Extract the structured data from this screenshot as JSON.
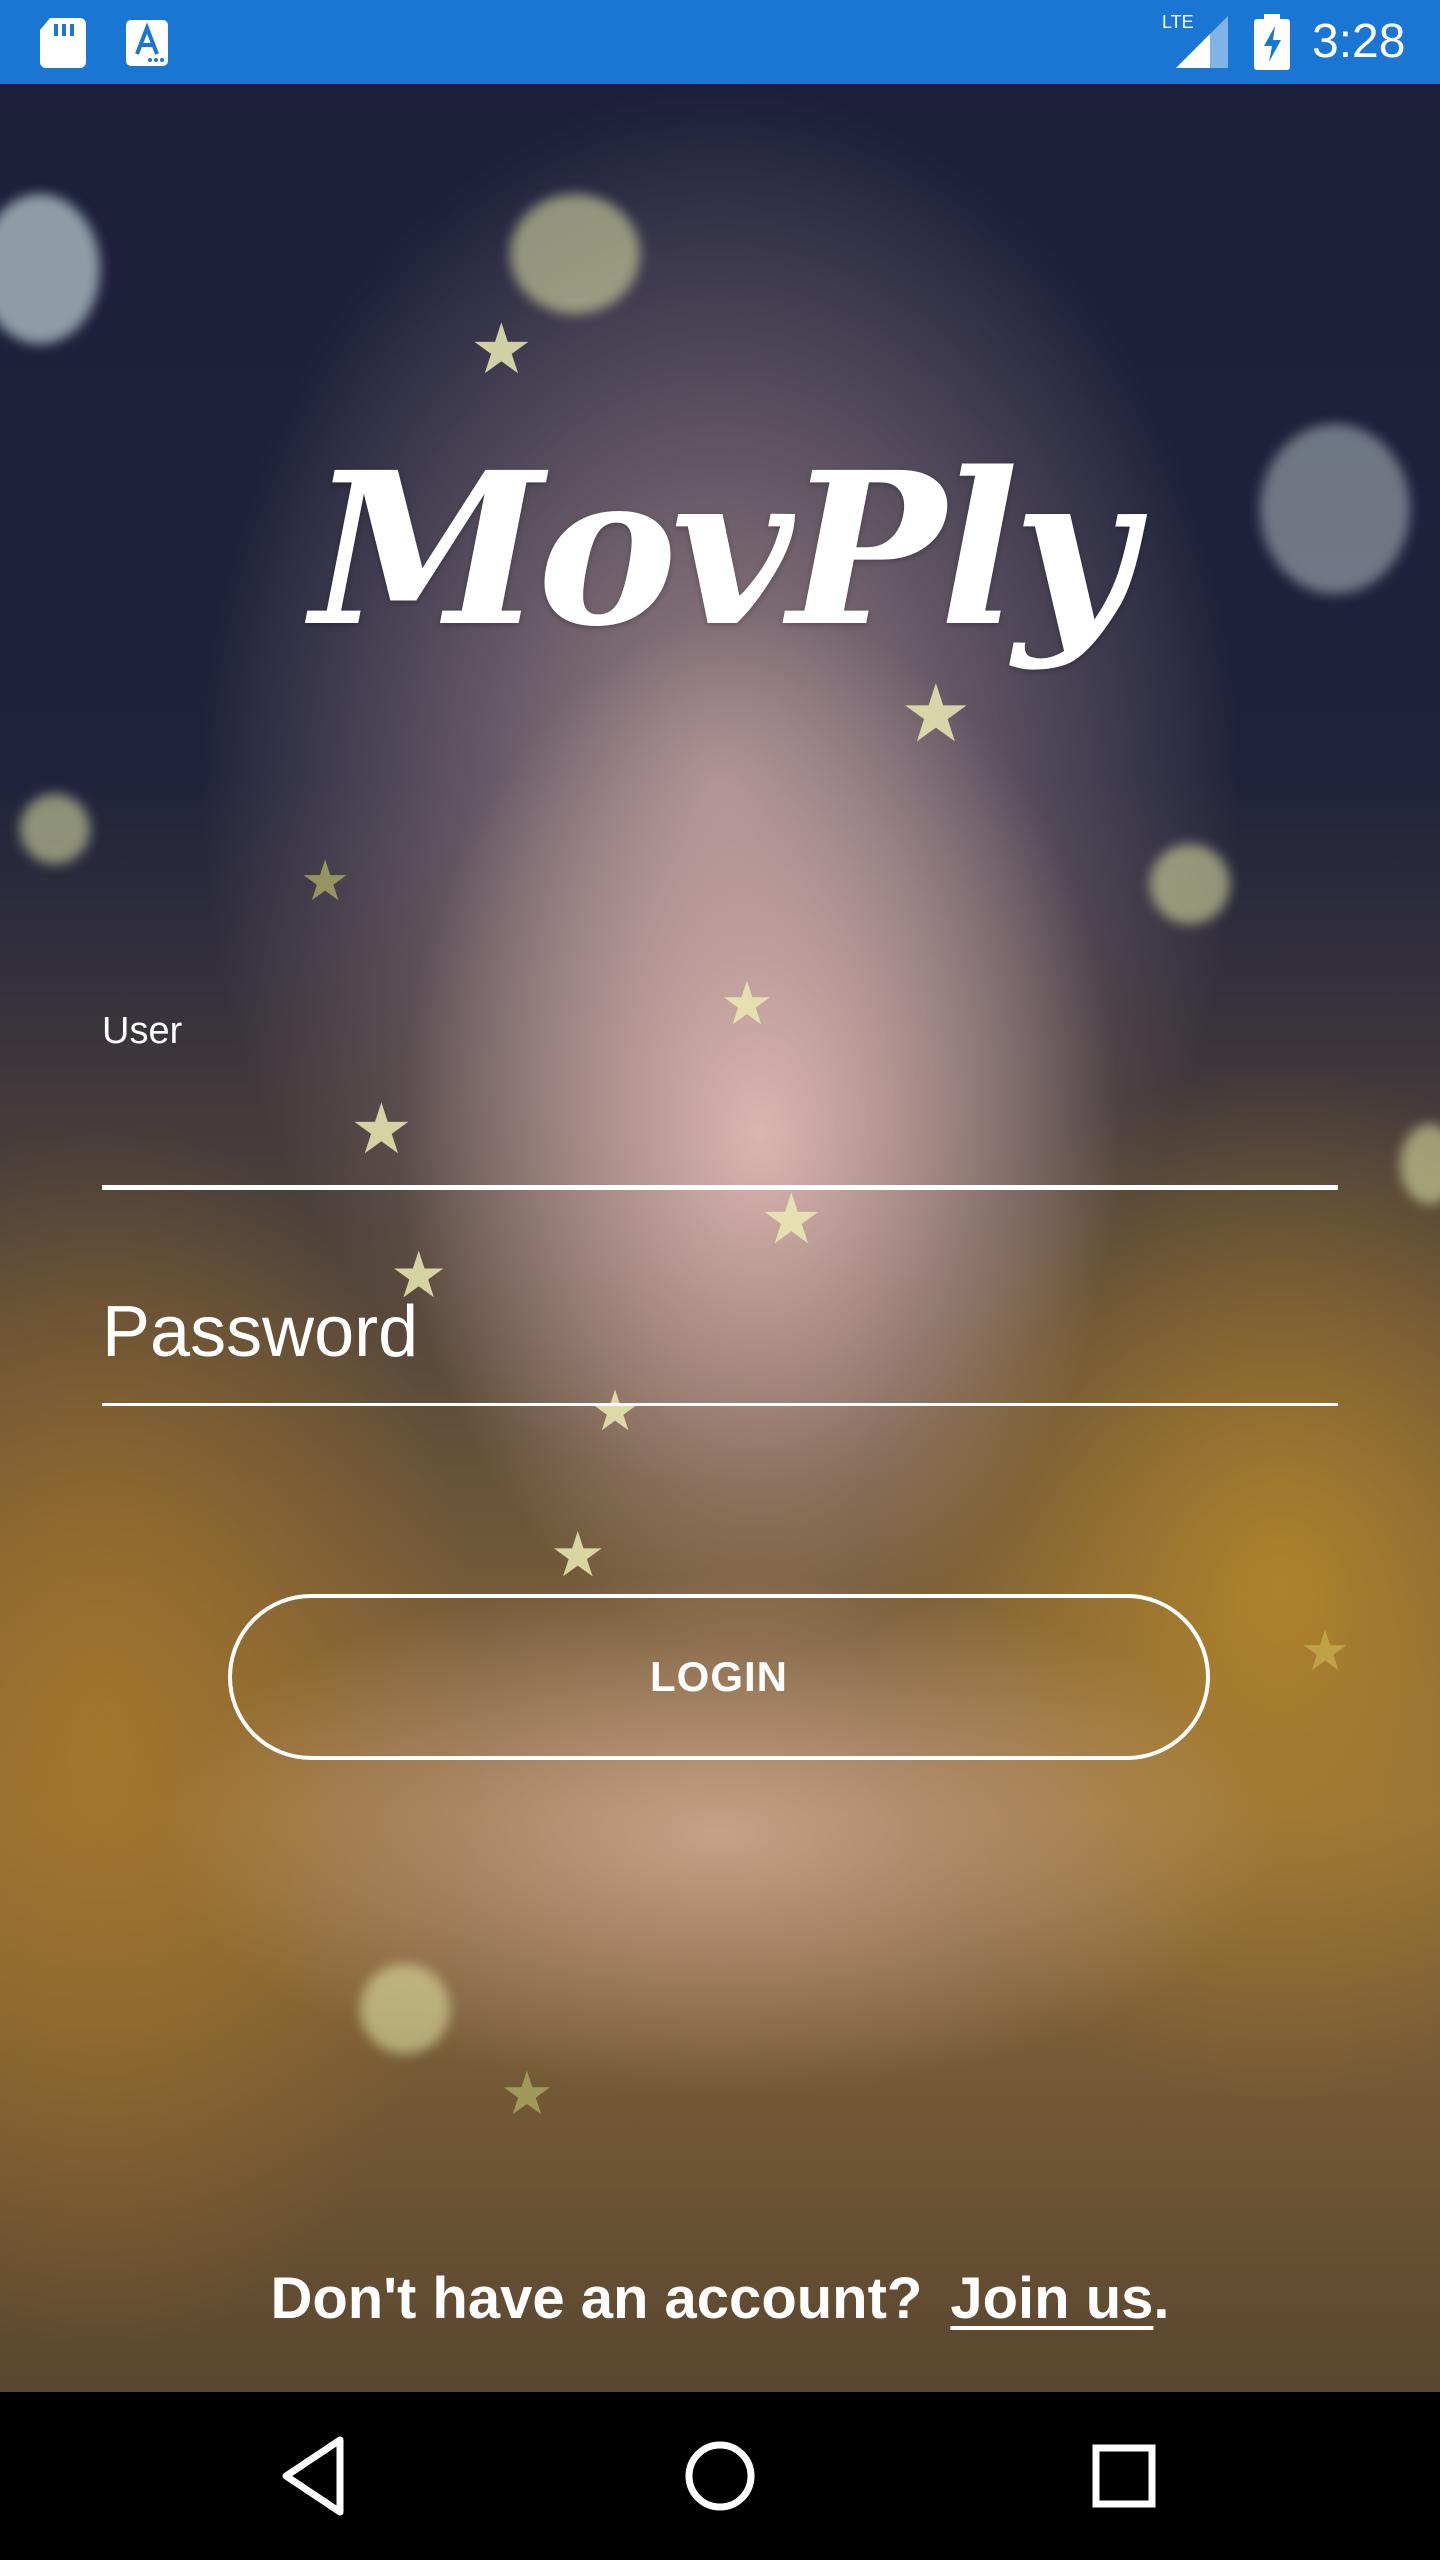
{
  "status_bar": {
    "time": "3:28",
    "network": "LTE",
    "color": "#1976d2",
    "icons": [
      "sd-card-icon",
      "font-a-icon",
      "lte-signal-icon",
      "battery-charging-icon"
    ]
  },
  "app": {
    "logo_text": "MovPly"
  },
  "login_form": {
    "user_label": "User",
    "user_value": "",
    "password_placeholder": "Password",
    "login_button_label": "LOGIN"
  },
  "signup": {
    "prompt": "Don't have an account?",
    "link_text": "Join us",
    "trailing": "."
  },
  "navigation_bar": {
    "buttons": [
      "back-icon",
      "home-icon",
      "recents-icon"
    ]
  }
}
